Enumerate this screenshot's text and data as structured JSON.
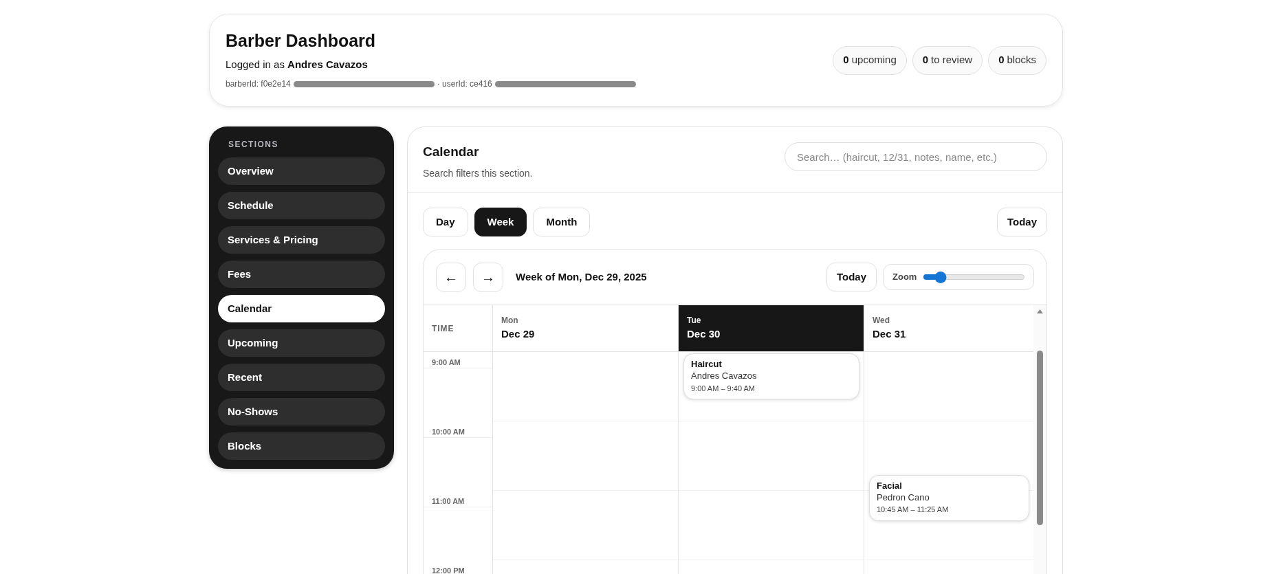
{
  "header": {
    "title": "Barber Dashboard",
    "logged_in": "Logged in as **Andres Cavazos**",
    "ids": [
      {
        "text": "barberId: f0e2e14",
        "redacted": true
      },
      {
        "text": "· userId: ce416",
        "redacted": true
      }
    ],
    "stats": [
      {
        "count": "0",
        "label": "upcoming"
      },
      {
        "count": "0",
        "label": "to review"
      },
      {
        "count": "0",
        "label": "blocks"
      }
    ]
  },
  "sidebar": {
    "heading": "SECTIONS",
    "items": [
      {
        "label": "Overview",
        "selected": false
      },
      {
        "label": "Schedule",
        "selected": false
      },
      {
        "label": "Services & Pricing",
        "selected": false
      },
      {
        "label": "Fees",
        "selected": false
      },
      {
        "label": "Calendar",
        "selected": true
      },
      {
        "label": "Upcoming",
        "selected": false
      },
      {
        "label": "Recent",
        "selected": false
      },
      {
        "label": "No-Shows",
        "selected": false
      },
      {
        "label": "Blocks",
        "selected": false
      }
    ]
  },
  "panel": {
    "title": "Calendar",
    "subtitle": "Search filters this section.",
    "search": {
      "placeholder": "Search… (haircut, 12/31, notes, name, etc.)"
    },
    "views": [
      {
        "label": "Day",
        "selected": false
      },
      {
        "label": "Week",
        "selected": true
      },
      {
        "label": "Month",
        "selected": false
      }
    ],
    "today_button": "Today",
    "calendar": {
      "prev": "←",
      "next": "→",
      "range": "Week of Mon, Dec 29, 2025",
      "today_button": "Today",
      "zoom": {
        "label": "Zoom",
        "level": 0.17
      },
      "time_heading": "TIME",
      "times": [
        "9:00 AM",
        "10:00 AM",
        "11:00 AM",
        "12:00 PM"
      ],
      "days": [
        {
          "weekday": "Mon",
          "date": "Dec 29",
          "selected": false
        },
        {
          "weekday": "Tue",
          "date": "Dec 30",
          "selected": true,
          "events": [
            {
              "title": "Haircut",
              "client": "Andres Cavazos",
              "time": "9:00 AM – 9:40 AM"
            }
          ]
        },
        {
          "weekday": "Wed",
          "date": "Dec 31",
          "selected": false,
          "events": [
            {
              "title": "Facial",
              "client": "Pedron Cano",
              "time": "10:45 AM – 11:25 AM"
            }
          ]
        }
      ]
    }
  }
}
